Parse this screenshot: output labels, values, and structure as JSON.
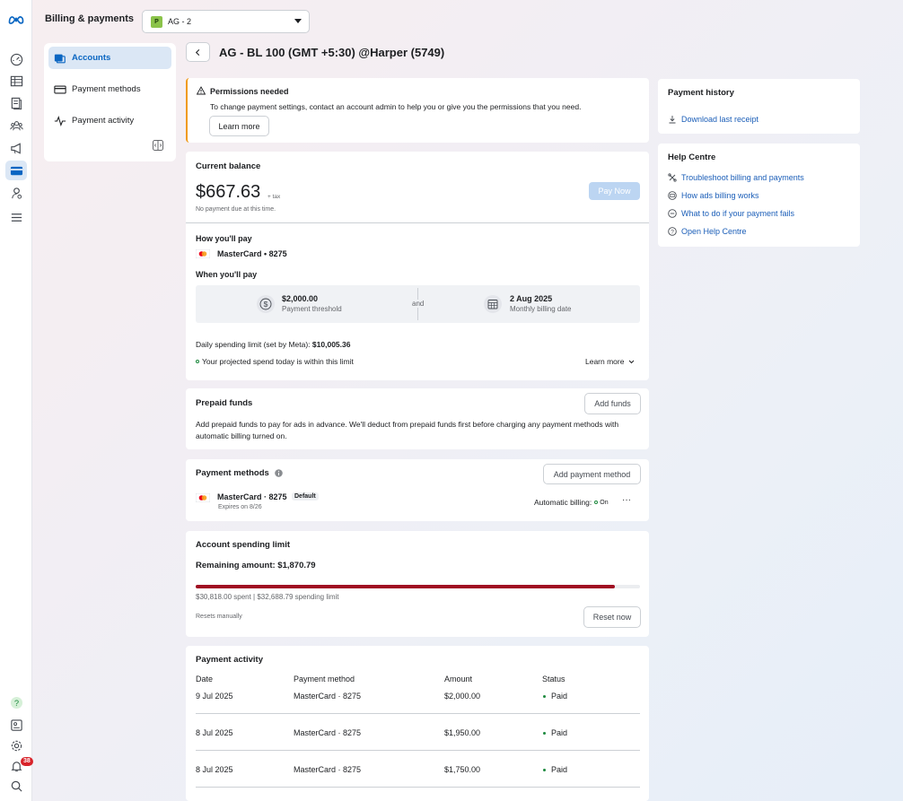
{
  "rail": {
    "items": [
      {
        "icon": "meta-logo-icon"
      },
      {
        "icon": "dashboard-icon"
      },
      {
        "icon": "table-icon"
      },
      {
        "icon": "pages-icon"
      },
      {
        "icon": "audience-icon"
      },
      {
        "icon": "megaphone-icon"
      },
      {
        "icon": "billing-card-icon"
      },
      {
        "icon": "business-settings-icon"
      },
      {
        "icon": "menu-icon"
      }
    ],
    "bottom": [
      {
        "icon": "help-icon"
      },
      {
        "icon": "news-icon"
      },
      {
        "icon": "settings-icon"
      },
      {
        "icon": "notifications-icon"
      },
      {
        "icon": "search-icon"
      }
    ],
    "notifications_count": "38"
  },
  "header": {
    "title": "Billing & payments",
    "account_chip": "P",
    "account_name": "AG - 2"
  },
  "sidebar": {
    "items": [
      {
        "label": "Accounts",
        "active": true
      },
      {
        "label": "Payment methods",
        "active": false
      },
      {
        "label": "Payment activity",
        "active": false
      }
    ]
  },
  "page": {
    "title": "AG - BL 100 (GMT +5:30) @Harper (5749)"
  },
  "permissions": {
    "title": "Permissions needed",
    "body": "To change payment settings, contact an account admin to help you or give you the permissions that you need.",
    "button": "Learn more"
  },
  "balance": {
    "title": "Current balance",
    "amount": "$667.63",
    "tax": "+ tax",
    "note": "No payment due at this time.",
    "pay_button": "Pay Now",
    "how_title": "How you'll pay",
    "card": "MasterCard • 8275",
    "when_title": "When you'll pay",
    "threshold_value": "$2,000.00",
    "threshold_label": "Payment threshold",
    "and": "and",
    "date_value": "2 Aug 2025",
    "date_label": "Monthly billing date",
    "daily_limit_label": "Daily spending limit (set by Meta): ",
    "daily_limit_value": "$10,005.36",
    "projected": "Your projected spend today is within this limit",
    "learn_more": "Learn more"
  },
  "prepaid": {
    "title": "Prepaid funds",
    "button": "Add funds",
    "body": "Add prepaid funds to pay for ads in advance. We'll deduct from prepaid funds first before charging any payment methods with automatic billing turned on."
  },
  "payment_methods": {
    "title": "Payment methods",
    "button": "Add payment method",
    "card": "MasterCard · 8275",
    "default_badge": "Default",
    "expires": "Expires on 8/26",
    "auto_label": "Automatic billing:",
    "auto_value": "On",
    "more": "···"
  },
  "spending_limit": {
    "title": "Account spending limit",
    "remaining": "Remaining amount: $1,870.79",
    "progress_fraction": 0.943,
    "summary": "$30,818.00 spent | $32,688.79 spending limit",
    "resets": "Resets manually",
    "button": "Reset now"
  },
  "activity": {
    "title": "Payment activity",
    "headers": [
      "Date",
      "Payment method",
      "Amount",
      "Status"
    ],
    "rows": [
      {
        "date": "9 Jul 2025",
        "method": "MasterCard · 8275",
        "amount": "$2,000.00",
        "status": "Paid"
      },
      {
        "date": "8 Jul 2025",
        "method": "MasterCard · 8275",
        "amount": "$1,950.00",
        "status": "Paid"
      },
      {
        "date": "8 Jul 2025",
        "method": "MasterCard · 8275",
        "amount": "$1,750.00",
        "status": "Paid"
      }
    ]
  },
  "history": {
    "title": "Payment history",
    "link": "Download last receipt"
  },
  "help": {
    "title": "Help Centre",
    "links": [
      {
        "label": "Troubleshoot billing and payments",
        "icon": "tools-icon"
      },
      {
        "label": "How ads billing works",
        "icon": "billing-info-icon"
      },
      {
        "label": "What to do if your payment fails",
        "icon": "minus-circle-icon"
      },
      {
        "label": "Open Help Centre",
        "icon": "question-icon"
      }
    ]
  },
  "colors": {
    "accent": "#0a66c2",
    "link": "#1b5eb8",
    "warning": "#f09b1a",
    "progress": "#a00d22",
    "paid": "#1e8a3f"
  }
}
